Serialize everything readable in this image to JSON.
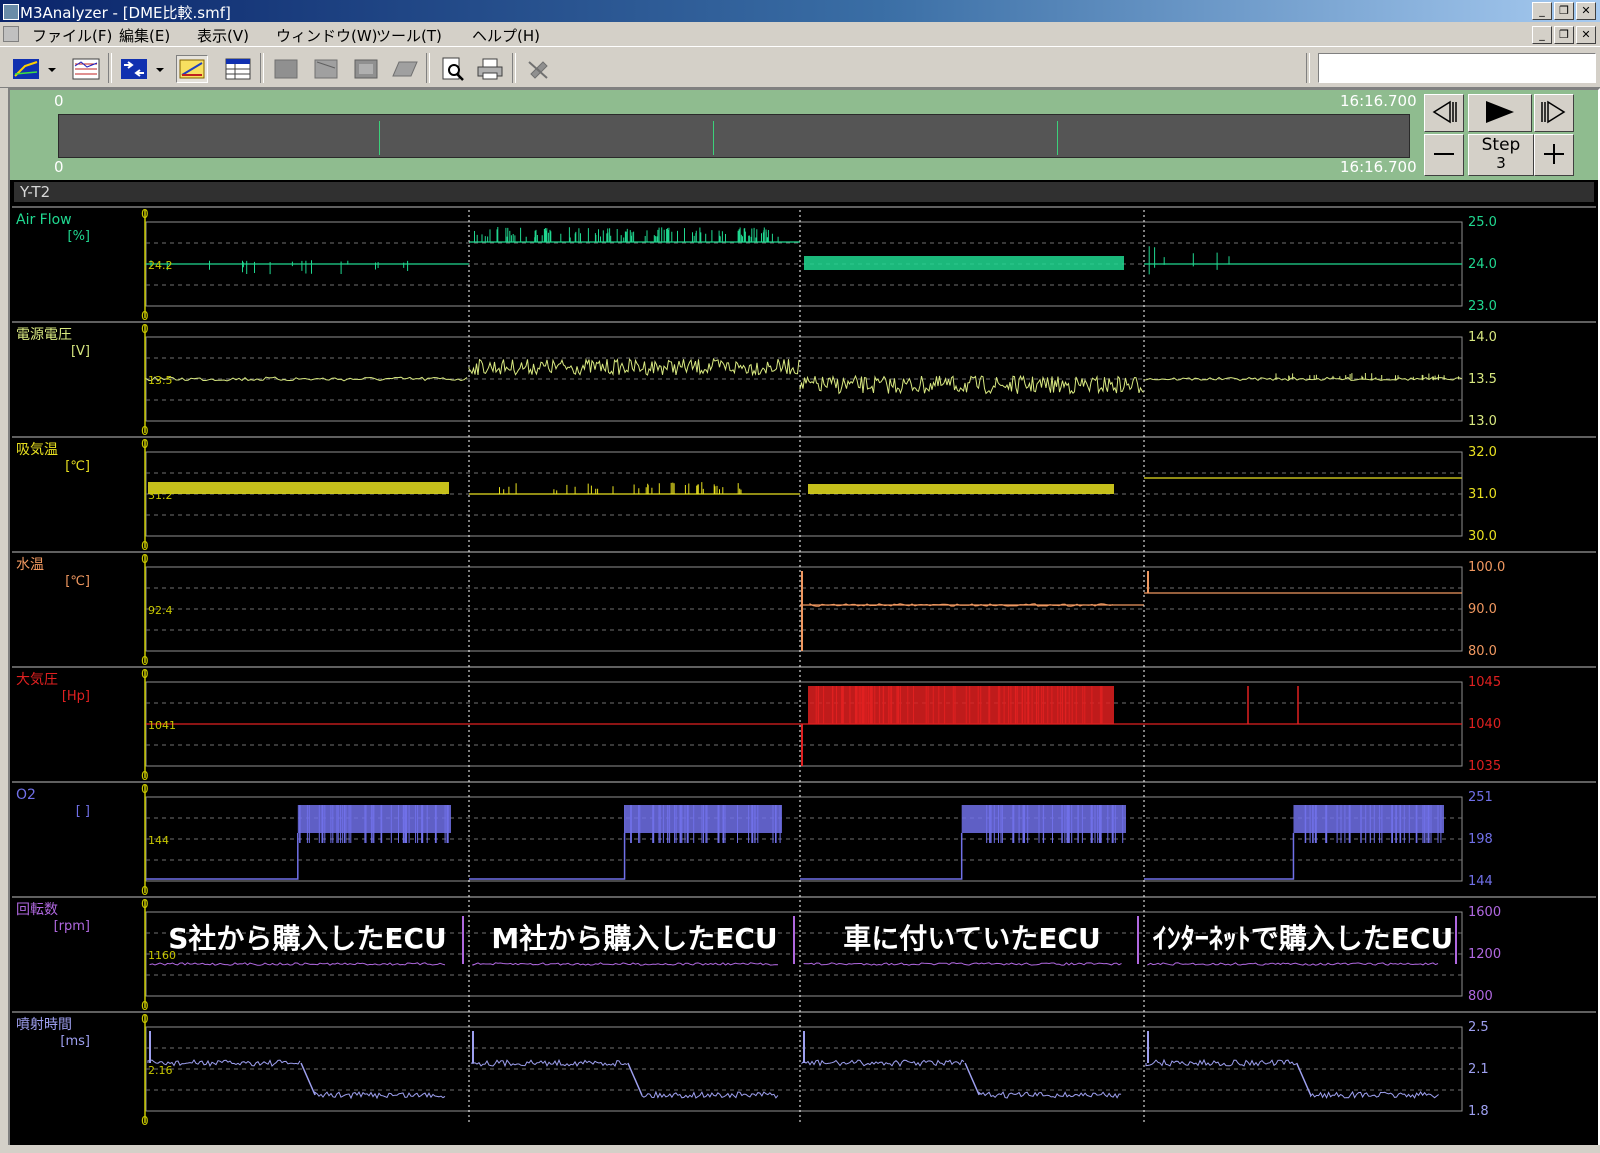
{
  "window": {
    "title": "M3Analyzer - [DME比較.smf]"
  },
  "menu": [
    "ファイル(F)",
    "編集(E)",
    "表示(V)",
    "ウィンドウ(W)",
    "ツール(T)",
    "ヘルプ(H)"
  ],
  "timebar": {
    "start_top": "0",
    "end_top": "16:16.700",
    "start_bottom": "0",
    "end_bottom": "16:16.700",
    "step_label": "Step",
    "step_value": "3"
  },
  "panel": {
    "title": "Y-T2"
  },
  "channels": [
    {
      "name": "Air Flow",
      "unit": "[%]",
      "color": "#20d890",
      "current": "24.2",
      "scale_max": "25.0",
      "scale_mid": "24.0",
      "scale_min": "23.0",
      "axis_top": "0",
      "axis_bottom": "0"
    },
    {
      "name": "電源電圧",
      "unit": "[V]",
      "color": "#d8e880",
      "current": "13.5",
      "scale_max": "14.0",
      "scale_mid": "13.5",
      "scale_min": "13.0",
      "axis_top": "0",
      "axis_bottom": "0"
    },
    {
      "name": "吸気温",
      "unit": "[℃]",
      "color": "#e8e020",
      "current": "31.2",
      "scale_max": "32.0",
      "scale_mid": "31.0",
      "scale_min": "30.0",
      "axis_top": "0",
      "axis_bottom": "0"
    },
    {
      "name": "水温",
      "unit": "[℃]",
      "color": "#f09860",
      "current": "92.4",
      "scale_max": "100.0",
      "scale_mid": "90.0",
      "scale_min": "80.0",
      "axis_top": "0",
      "axis_bottom": "0"
    },
    {
      "name": "大気圧",
      "unit": "[Hp]",
      "color": "#e02020",
      "current": "1041",
      "scale_max": "1045",
      "scale_mid": "1040",
      "scale_min": "1035",
      "axis_top": "0",
      "axis_bottom": "0"
    },
    {
      "name": "O2",
      "unit": "[ ]",
      "color": "#7070e8",
      "current": "144",
      "scale_max": "251",
      "scale_mid": "198",
      "scale_min": "144",
      "axis_top": "0",
      "axis_bottom": "0"
    },
    {
      "name": "回転数",
      "unit": "[rpm]",
      "color": "#b068e0",
      "current": "1160",
      "scale_max": "1600",
      "scale_mid": "1200",
      "scale_min": "800",
      "axis_top": "0",
      "axis_bottom": "0"
    },
    {
      "name": "噴射時間",
      "unit": "[ms]",
      "color": "#9ea0f0",
      "current": "2.16",
      "scale_max": "2.5",
      "scale_mid": "2.1",
      "scale_min": "1.8",
      "axis_top": "0",
      "axis_bottom": "0"
    }
  ],
  "annotations": [
    "S社から購入したECU",
    "M社から購入したECU",
    "車に付いていたECU",
    "ｲﾝﾀｰﾈｯﾄで購入したECU"
  ],
  "colors": {
    "axis": "#c8c800",
    "grid": "#707070",
    "plot_border": "#909090",
    "annotation": "#ffffff"
  }
}
